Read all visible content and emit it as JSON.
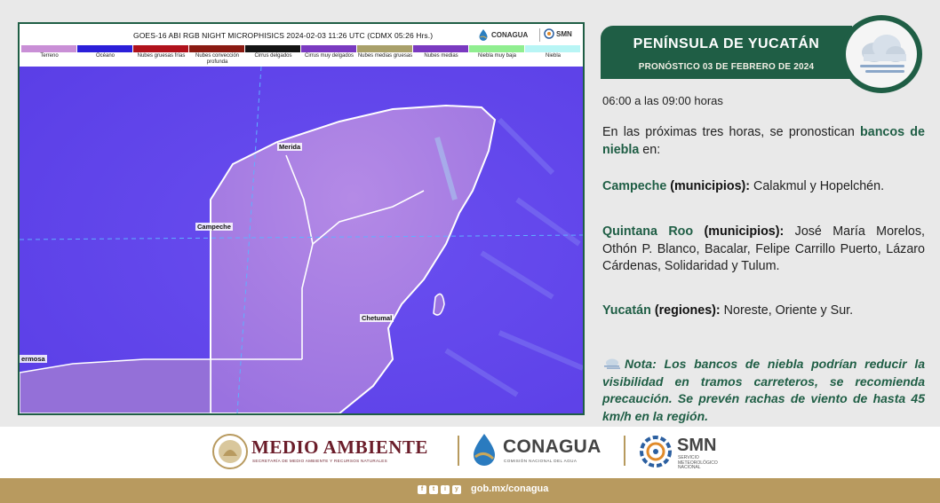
{
  "satellite": {
    "title": "GOES-16 ABI RGB NIGHT MICROPHISICS 2024-02-03 11:26 UTC (CDMX  05:26 Hrs.)",
    "header_logos": {
      "conagua": "CONAGUA",
      "smn": "SMN"
    },
    "legend": [
      {
        "label": "Terreno",
        "color": "#c98fd6"
      },
      {
        "label": "Océano",
        "color": "#2b1fd9"
      },
      {
        "label": "Nubes gruesas frías",
        "color": "#b0121c"
      },
      {
        "label": "Nubes convección profunda",
        "color": "#8a1a12"
      },
      {
        "label": "Cirrus delgados",
        "color": "#141414"
      },
      {
        "label": "Cirrus muy delgados",
        "color": "#7a3ac0"
      },
      {
        "label": "Nubes medias gruesas",
        "color": "#a9a06a"
      },
      {
        "label": "Nubes medias",
        "color": "#7a3ac0"
      },
      {
        "label": "Niebla muy baja",
        "color": "#90ee90"
      },
      {
        "label": "Niebla",
        "color": "#b8f5f5"
      }
    ],
    "cities": {
      "merida": "Merida",
      "campeche": "Campeche",
      "chetumal": "Chetumal",
      "hermosa": "ermosa"
    }
  },
  "banner": {
    "region": "PENÍNSULA DE YUCATÁN",
    "date": "PRONÓSTICO 03 DE FEBRERO DE 2024",
    "weather_icon": "fog-cloud-icon"
  },
  "content": {
    "time_range": "06:00 a las 09:00 horas",
    "intro_text": "En las próximas tres horas, se pronostican ",
    "intro_highlight": "bancos de niebla",
    "intro_end": " en:",
    "campeche_state": "Campeche",
    "campeche_kind": "(municipios):",
    "campeche_places": "Calakmul y Hopelchén.",
    "qroo_state": "Quintana Roo",
    "qroo_kind": "(municipios):",
    "qroo_places": "José María Morelos, Othón P. Blanco, Bacalar, Felipe Carrillo Puerto, Lázaro Cárdenas, Solidaridad y Tulum.",
    "yucatan_state": "Yucatán",
    "yucatan_kind": "(regiones):",
    "yucatan_places": "Noreste, Oriente y Sur.",
    "note_label": "Nota:",
    "note_text": "Los bancos de niebla podrían reducir la visibilidad en tramos carreteros, se recomienda precaución. Se prevén rachas de viento de hasta 45 km/h en la región."
  },
  "footer": {
    "medio_ambiente": "MEDIO AMBIENTE",
    "medio_ambiente_sub": "SECRETARÍA DE MEDIO AMBIENTE Y RECURSOS NATURALES",
    "conagua": "CONAGUA",
    "conagua_sub": "COMISIÓN NACIONAL DEL AGUA",
    "smn": "SMN",
    "smn_sub": "SERVICIO METEOROLÓGICO NACIONAL",
    "social": [
      "f",
      "t",
      "i",
      "y"
    ],
    "url": "gob.mx/conagua",
    "colors": {
      "guinda": "#6b1d2a",
      "dorado": "#b89a5f",
      "verde": "#1f5e45"
    }
  }
}
